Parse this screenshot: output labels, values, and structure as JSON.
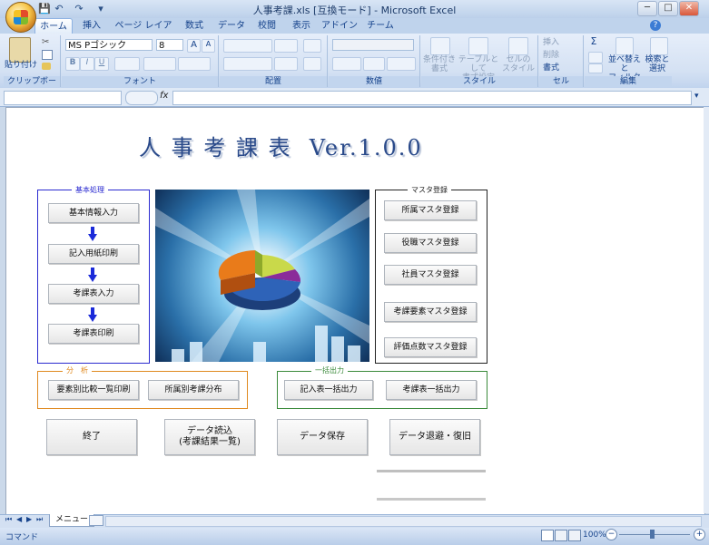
{
  "window": {
    "title": "人事考課.xls  [互換モード] - Microsoft Excel",
    "controls": [
      "─",
      "□",
      "✕"
    ]
  },
  "quick_access": {
    "save": "💾",
    "undo": "↶",
    "redo": "↷",
    "customize": "▾"
  },
  "tabs": [
    "ホーム",
    "挿入",
    "ページ レイアウト",
    "数式",
    "データ",
    "校閲",
    "表示",
    "アドイン",
    "チーム"
  ],
  "active_tab": "ホーム",
  "ribbon": {
    "clipboard": {
      "label": "クリップボード",
      "paste": "貼り付け"
    },
    "font": {
      "label": "フォント",
      "name": "MS Pゴシック",
      "size": "8",
      "bold": "B",
      "italic": "I",
      "underline": "U",
      "grow": "A",
      "shrink": "A"
    },
    "alignment": {
      "label": "配置"
    },
    "number": {
      "label": "数値"
    },
    "style": {
      "label": "スタイル",
      "conditional": "条件付き\n書式",
      "table": "テーブルとして\n書式設定",
      "cell": "セルの\nスタイル"
    },
    "cells": {
      "label": "セル",
      "insert": "挿入",
      "delete": "削除",
      "format": "書式"
    },
    "editing": {
      "label": "編集",
      "sum": "Σ",
      "sort": "並べ替えと\nフィルタ",
      "find": "検索と\n選択"
    }
  },
  "formula_bar": {
    "fx": "fx",
    "name_value": "",
    "formula_value": ""
  },
  "sheet": {
    "title": "人 事 考 課 表  Ver.1.0.0",
    "basic": {
      "label": "基本処理",
      "buttons": [
        "基本情報入力",
        "記入用紙印刷",
        "考課表入力",
        "考課表印刷"
      ]
    },
    "master": {
      "label": "マスタ登録",
      "buttons": [
        "所属マスタ登録",
        "役職マスタ登録",
        "社員マスタ登録",
        "考課要素マスタ登録",
        "評価点数マスタ登録"
      ]
    },
    "analysis": {
      "label": "分　析",
      "buttons": [
        "要素別比較一覧印刷",
        "所属別考課分布"
      ]
    },
    "batch": {
      "label": "一括出力",
      "buttons": [
        "記入表一括出力",
        "考課表一括出力"
      ]
    },
    "bottom_buttons": [
      "終了",
      "データ読込\n(考課結果一覧)",
      "データ保存",
      "データ退避・復旧"
    ],
    "footer_line1": "　",
    "footer_line2": "　"
  },
  "sheet_tabs": {
    "active": "メニュー",
    "nav": [
      "⏮",
      "◀",
      "▶",
      "⏭"
    ]
  },
  "status": {
    "mode": "コマンド",
    "zoom": "100%",
    "minus": "−",
    "plus": "+"
  },
  "colors": {
    "basic_frame": "#2a2ad0",
    "analysis_frame": "#e08a20",
    "batch_frame": "#3a8a3a",
    "master_frame": "#222222",
    "title_text": "#2a4a8a"
  }
}
